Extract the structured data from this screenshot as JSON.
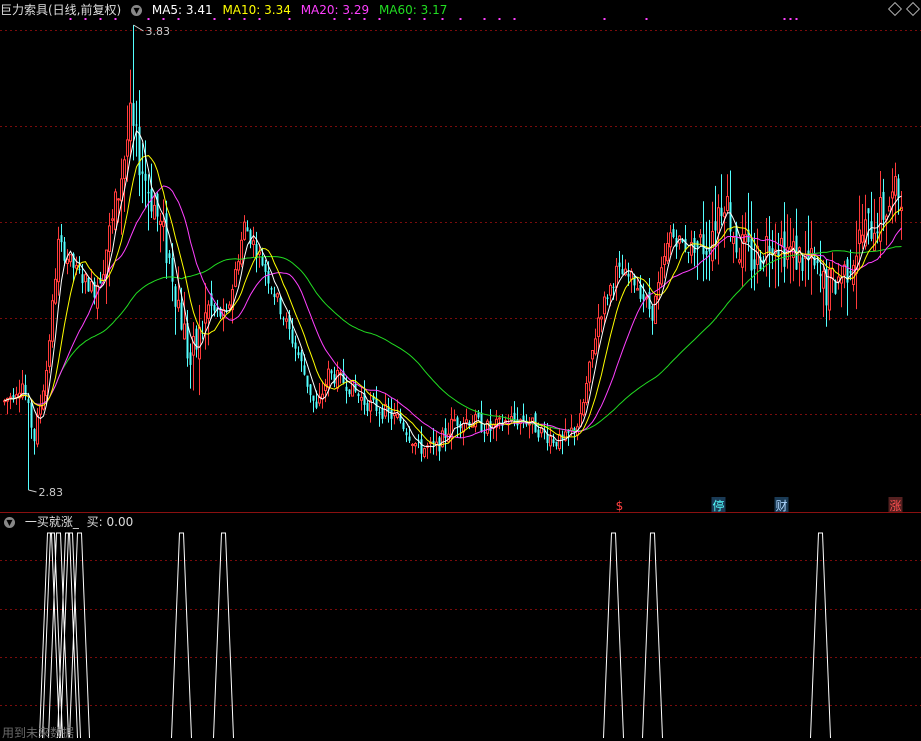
{
  "header": {
    "stock_name": "巨力索具(日线,前复权)",
    "ma5_label": "MA5: 3.41",
    "ma10_label": "MA10: 3.34",
    "ma20_label": "MA20: 3.29",
    "ma60_label": "MA60: 3.17"
  },
  "indicator": {
    "title": "一买就涨_",
    "buy_label": "买: 0.00"
  },
  "note": "用到未来数据",
  "markers": {
    "m1": "$",
    "m2": "停",
    "m3": "财",
    "m4": "涨"
  },
  "colors": {
    "up": "#ff3b3b",
    "down": "#54ffff",
    "ma5": "#ffffff",
    "ma10": "#ffff00",
    "ma20": "#ff40ff",
    "ma60": "#22dd22",
    "grid": "#7a0c0c",
    "dots": "#ff40ff"
  },
  "chart_data": [
    {
      "type": "candlestick",
      "high_label": "3.83",
      "low_label": "2.83",
      "price_range": [
        2.83,
        3.83
      ],
      "grid": true,
      "candles": [],
      "ma5": [],
      "ma10": [],
      "ma20": [],
      "ma60": []
    },
    {
      "type": "line",
      "name": "买",
      "ylim": [
        0,
        1
      ],
      "signals": [
        0,
        0,
        0,
        0,
        0,
        0,
        0,
        0,
        0,
        0,
        0,
        0,
        0,
        0,
        0,
        1,
        1,
        0,
        1,
        0,
        0,
        1,
        1,
        0,
        0,
        1,
        0,
        0,
        0,
        0,
        0,
        0,
        0,
        0,
        0,
        0,
        0,
        0,
        0,
        0,
        0,
        0,
        0,
        0,
        0,
        0,
        0,
        0,
        0,
        0,
        0,
        0,
        0,
        0,
        0,
        0,
        0,
        0,
        0,
        1,
        0,
        0,
        0,
        0,
        0,
        0,
        0,
        0,
        0,
        0,
        0,
        0,
        0,
        1,
        0,
        0,
        0,
        0,
        0,
        0,
        0,
        0,
        0,
        0,
        0,
        0,
        0,
        0,
        0,
        0,
        0,
        0,
        0,
        0,
        0,
        0,
        0,
        0,
        0,
        0,
        0,
        0,
        0,
        0,
        0,
        0,
        0,
        0,
        0,
        0,
        0,
        0,
        0,
        0,
        0,
        0,
        0,
        0,
        0,
        0,
        0,
        0,
        0,
        0,
        0,
        0,
        0,
        0,
        0,
        0,
        0,
        0,
        0,
        0,
        0,
        0,
        0,
        0,
        0,
        0,
        0,
        0,
        0,
        0,
        0,
        0,
        0,
        0,
        0,
        0,
        0,
        0,
        0,
        0,
        0,
        0,
        0,
        0,
        0,
        0,
        0,
        0,
        0,
        0,
        0,
        0,
        0,
        0,
        0,
        0,
        0,
        0,
        0,
        0,
        0,
        0,
        0,
        0,
        0,
        0,
        0,
        0,
        0,
        0,
        0,
        0,
        0,
        0,
        0,
        0,
        0,
        0,
        0,
        0,
        0,
        0,
        0,
        0,
        0,
        0,
        0,
        0,
        0,
        1,
        0,
        0,
        0,
        0,
        0,
        0,
        0,
        0,
        0,
        0,
        0,
        0,
        1,
        0,
        0,
        0,
        0,
        0,
        0,
        0,
        0,
        0,
        0,
        0,
        0,
        0,
        0,
        0,
        0,
        0,
        0,
        0,
        0,
        0,
        0,
        0,
        0,
        0,
        0,
        0,
        0,
        0,
        0,
        0,
        0,
        0,
        0,
        0,
        0,
        0,
        0,
        0,
        0,
        0,
        0,
        0,
        0,
        0,
        0,
        0,
        0,
        0,
        0,
        0,
        0,
        0,
        0,
        0,
        1,
        0,
        0,
        0
      ]
    }
  ]
}
